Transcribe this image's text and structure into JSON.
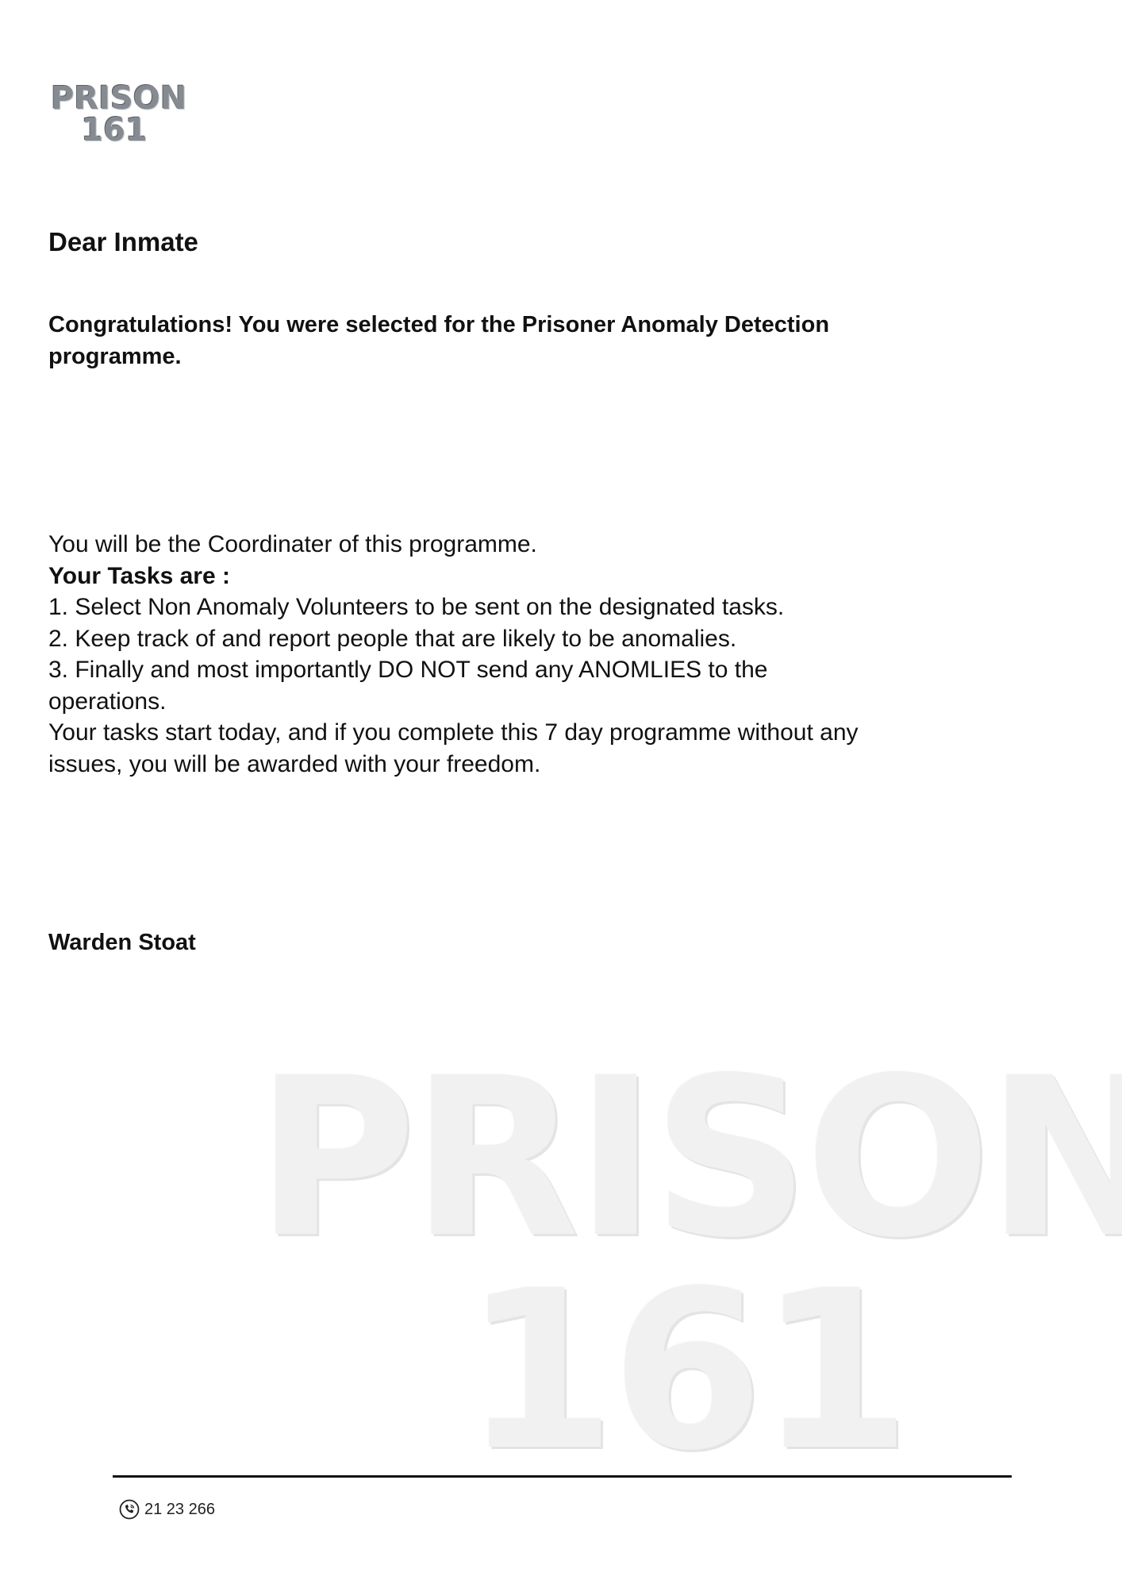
{
  "header": {
    "logo_line1": "PRISON",
    "logo_line2": "161"
  },
  "letter": {
    "greeting": "Dear Inmate",
    "headline": "Congratulations! You were selected for the Prisoner Anomaly Detection programme.",
    "intro": "You will be the Coordinater of this programme.",
    "tasks_heading": "Your Tasks are :",
    "tasks": [
      "1. Select Non Anomaly Volunteers to be sent on the designated tasks.",
      "2. Keep track of and report people that are likely to be anomalies.",
      "3. Finally and most importantly DO NOT send any ANOMLIES to the operations."
    ],
    "closing": "Your tasks start today, and if you complete this 7 day programme without any issues, you will be awarded with your freedom.",
    "signature": "Warden Stoat"
  },
  "watermark": {
    "line1": "PRISON",
    "line2": "161"
  },
  "footer": {
    "phone_icon": "phone-icon",
    "phone": "21 23 266"
  }
}
